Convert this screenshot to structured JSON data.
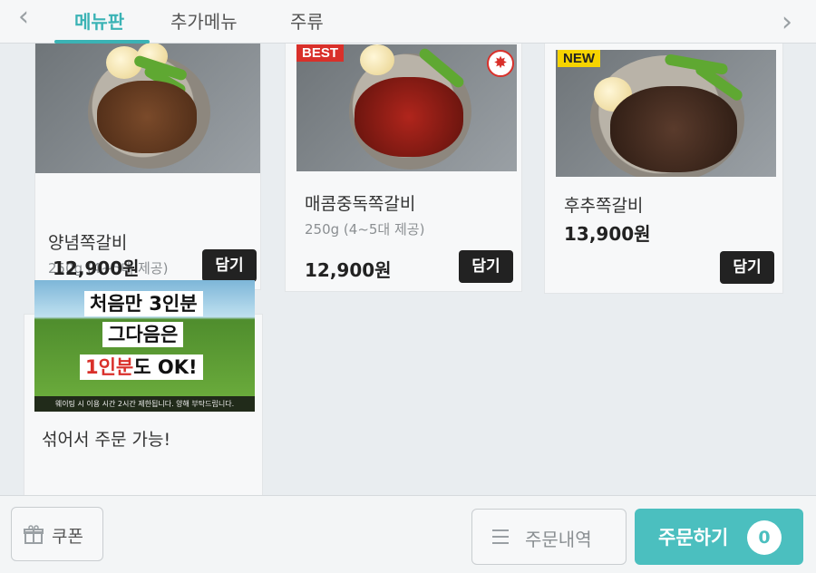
{
  "colors": {
    "accent": "#3bb3b5",
    "order_button": "#4bbfbf",
    "best_badge": "#d9302a",
    "new_badge": "#f6d400",
    "add_button": "#222222"
  },
  "nav": {
    "prev_icon": "chevron-left-icon",
    "next_icon": "chevron-right-icon",
    "prev_glyph": "‹",
    "next_glyph": "›"
  },
  "tabs": [
    {
      "label": "메뉴판",
      "active": true
    },
    {
      "label": "추가메뉴",
      "active": false
    },
    {
      "label": "주류",
      "active": false
    }
  ],
  "menu_items": [
    {
      "name": "양념쪽갈비",
      "weight": "250g (4~5대 제공)",
      "price": "12,900원",
      "add_label": "담기",
      "badge": ""
    },
    {
      "name": "매콤중독쪽갈비",
      "weight": "250g (4~5대 제공)",
      "price": "12,900원",
      "add_label": "담기",
      "badge": "BEST",
      "spicy_icon": "chili-pepper-icon"
    },
    {
      "name": "후추쪽갈비",
      "weight": "",
      "price": "13,900원",
      "add_label": "담기",
      "badge": "NEW"
    }
  ],
  "promo": {
    "line1": "처음만 3인분",
    "line2": "그다음은",
    "line3_red": "1인분",
    "line3_rest": "도 OK!",
    "footnote": "웨이팅 시 이용 시간 2시간 제한됩니다. 양해 부탁드립니다.",
    "caption": "섞어서 주문 가능!"
  },
  "bottom": {
    "coupon_label": "쿠폰",
    "coupon_icon": "gift-box-icon",
    "history_label": "주문내역",
    "history_icon": "list-icon",
    "order_label": "주문하기",
    "cart_count": "0"
  }
}
